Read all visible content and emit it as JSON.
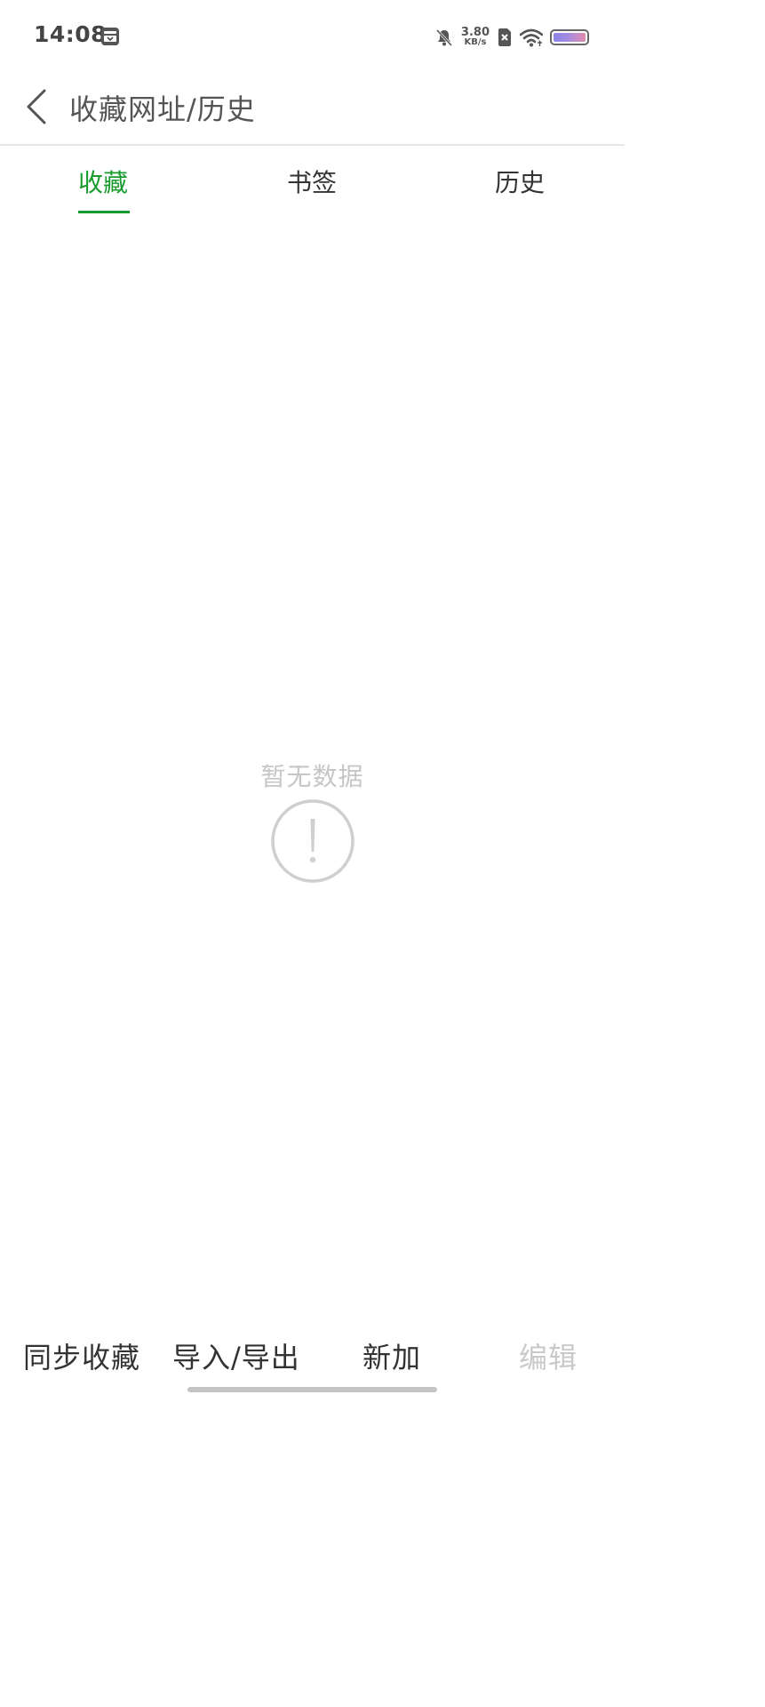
{
  "status_bar": {
    "time": "14:08",
    "net_speed_value": "3.80",
    "net_speed_unit": "KB/s",
    "icons": [
      "app-notification-icon",
      "bell-muted-icon",
      "sim-disabled-icon",
      "wifi-icon",
      "battery-icon"
    ],
    "battery_colors": [
      "#8a86e8",
      "#e18aa9"
    ]
  },
  "header": {
    "title": "收藏网址/历史",
    "back_icon": "chevron-left-icon"
  },
  "tabs": [
    {
      "label": "收藏",
      "active": true
    },
    {
      "label": "书签",
      "active": false
    },
    {
      "label": "历史",
      "active": false
    }
  ],
  "empty_state": {
    "message": "暂无数据",
    "icon": "exclamation-circle-icon"
  },
  "toolbar": {
    "sync": "同步收藏",
    "import_export": "导入/导出",
    "add": "新加",
    "edit": "编辑",
    "edit_enabled": false
  },
  "colors": {
    "accent": "#1a9b2e",
    "muted": "#c6c6c6",
    "text": "#333333"
  }
}
